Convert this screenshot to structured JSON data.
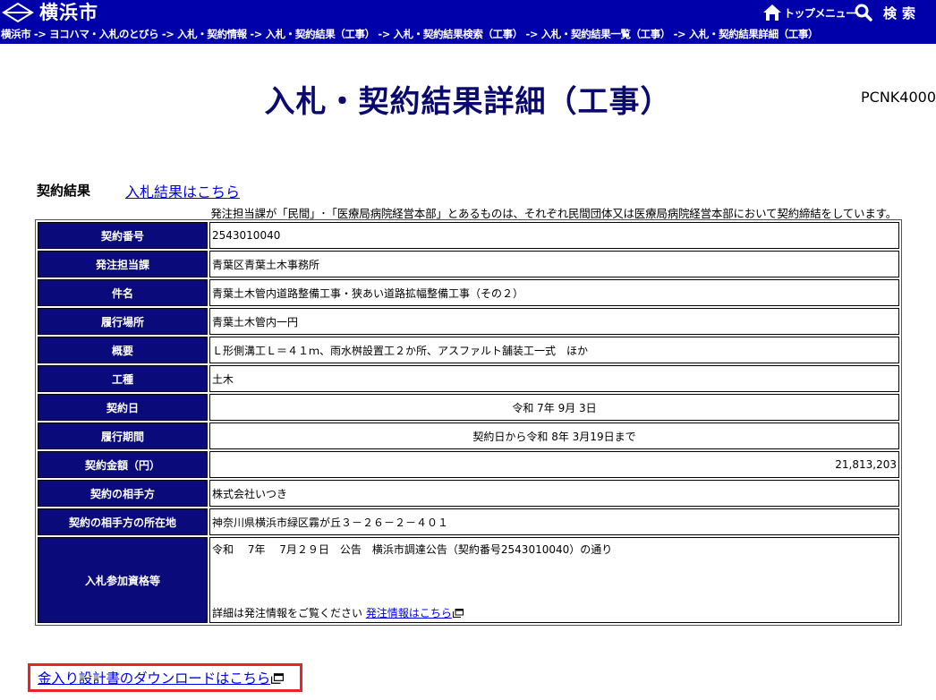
{
  "header": {
    "site_name": "横浜市",
    "top_menu_label": "トップメニュー",
    "search_label": "検索"
  },
  "breadcrumb": {
    "items": [
      "横浜市",
      "ヨコハマ・入札のとびら",
      "入札・契約情報",
      "入札・契約結果（工事）",
      "入札・契約結果検索（工事）",
      "入札・契約結果一覧（工事）",
      "入札・契約結果詳細（工事）"
    ],
    "separator": " -> "
  },
  "page": {
    "title": "入札・契約結果詳細（工事）",
    "code": "PCNK4000"
  },
  "section": {
    "heading": "契約結果",
    "bid_result_link": "入札結果はこちら",
    "notice": "発注担当課が「民間」･「医療局病院経営本部」とあるものは、それぞれ民間団体又は医療局病院経営本部において契約締結をしています。"
  },
  "table": {
    "rows": [
      {
        "label": "契約番号",
        "value": "2543010040"
      },
      {
        "label": "発注担当課",
        "value": "青葉区青葉土木事務所"
      },
      {
        "label": "件名",
        "value": "青葉土木管内道路整備工事・狭あい道路拡幅整備工事（その２）"
      },
      {
        "label": "履行場所",
        "value": "青葉土木管内一円"
      },
      {
        "label": "概要",
        "value": "Ｌ形側溝工Ｌ＝４１ｍ、雨水桝設置工２か所、アスファルト舗装工一式　ほか"
      },
      {
        "label": "工種",
        "value": "土木"
      },
      {
        "label": "契約日",
        "value": "令和 7年 9月 3日"
      },
      {
        "label": "履行期間",
        "value": "契約日から令和 8年 3月19日まで"
      },
      {
        "label": "契約金額（円）",
        "value": "21,813,203"
      },
      {
        "label": "契約の相手方",
        "value": "株式会社いつき"
      },
      {
        "label": "契約の相手方の所在地",
        "value": "神奈川県横浜市緑区霧が丘３－２６－２－４０１"
      }
    ],
    "qualification": {
      "label": "入札参加資格等",
      "line1": "令和　 7年　 7月２９日　公告　横浜市調達公告（契約番号2543010040）の通り",
      "line2_text": "詳細は発注情報をご覧ください ",
      "line2_link": "発注情報はこちら"
    }
  },
  "download": {
    "link_text": "金入り設計書のダウンロードはこちら"
  },
  "colors": {
    "header_bg": "#0000aa",
    "table_header_bg": "#0a0a7a",
    "title_color": "#0a0a6e",
    "highlight_border": "#e8232a",
    "link": "#0000ee"
  }
}
